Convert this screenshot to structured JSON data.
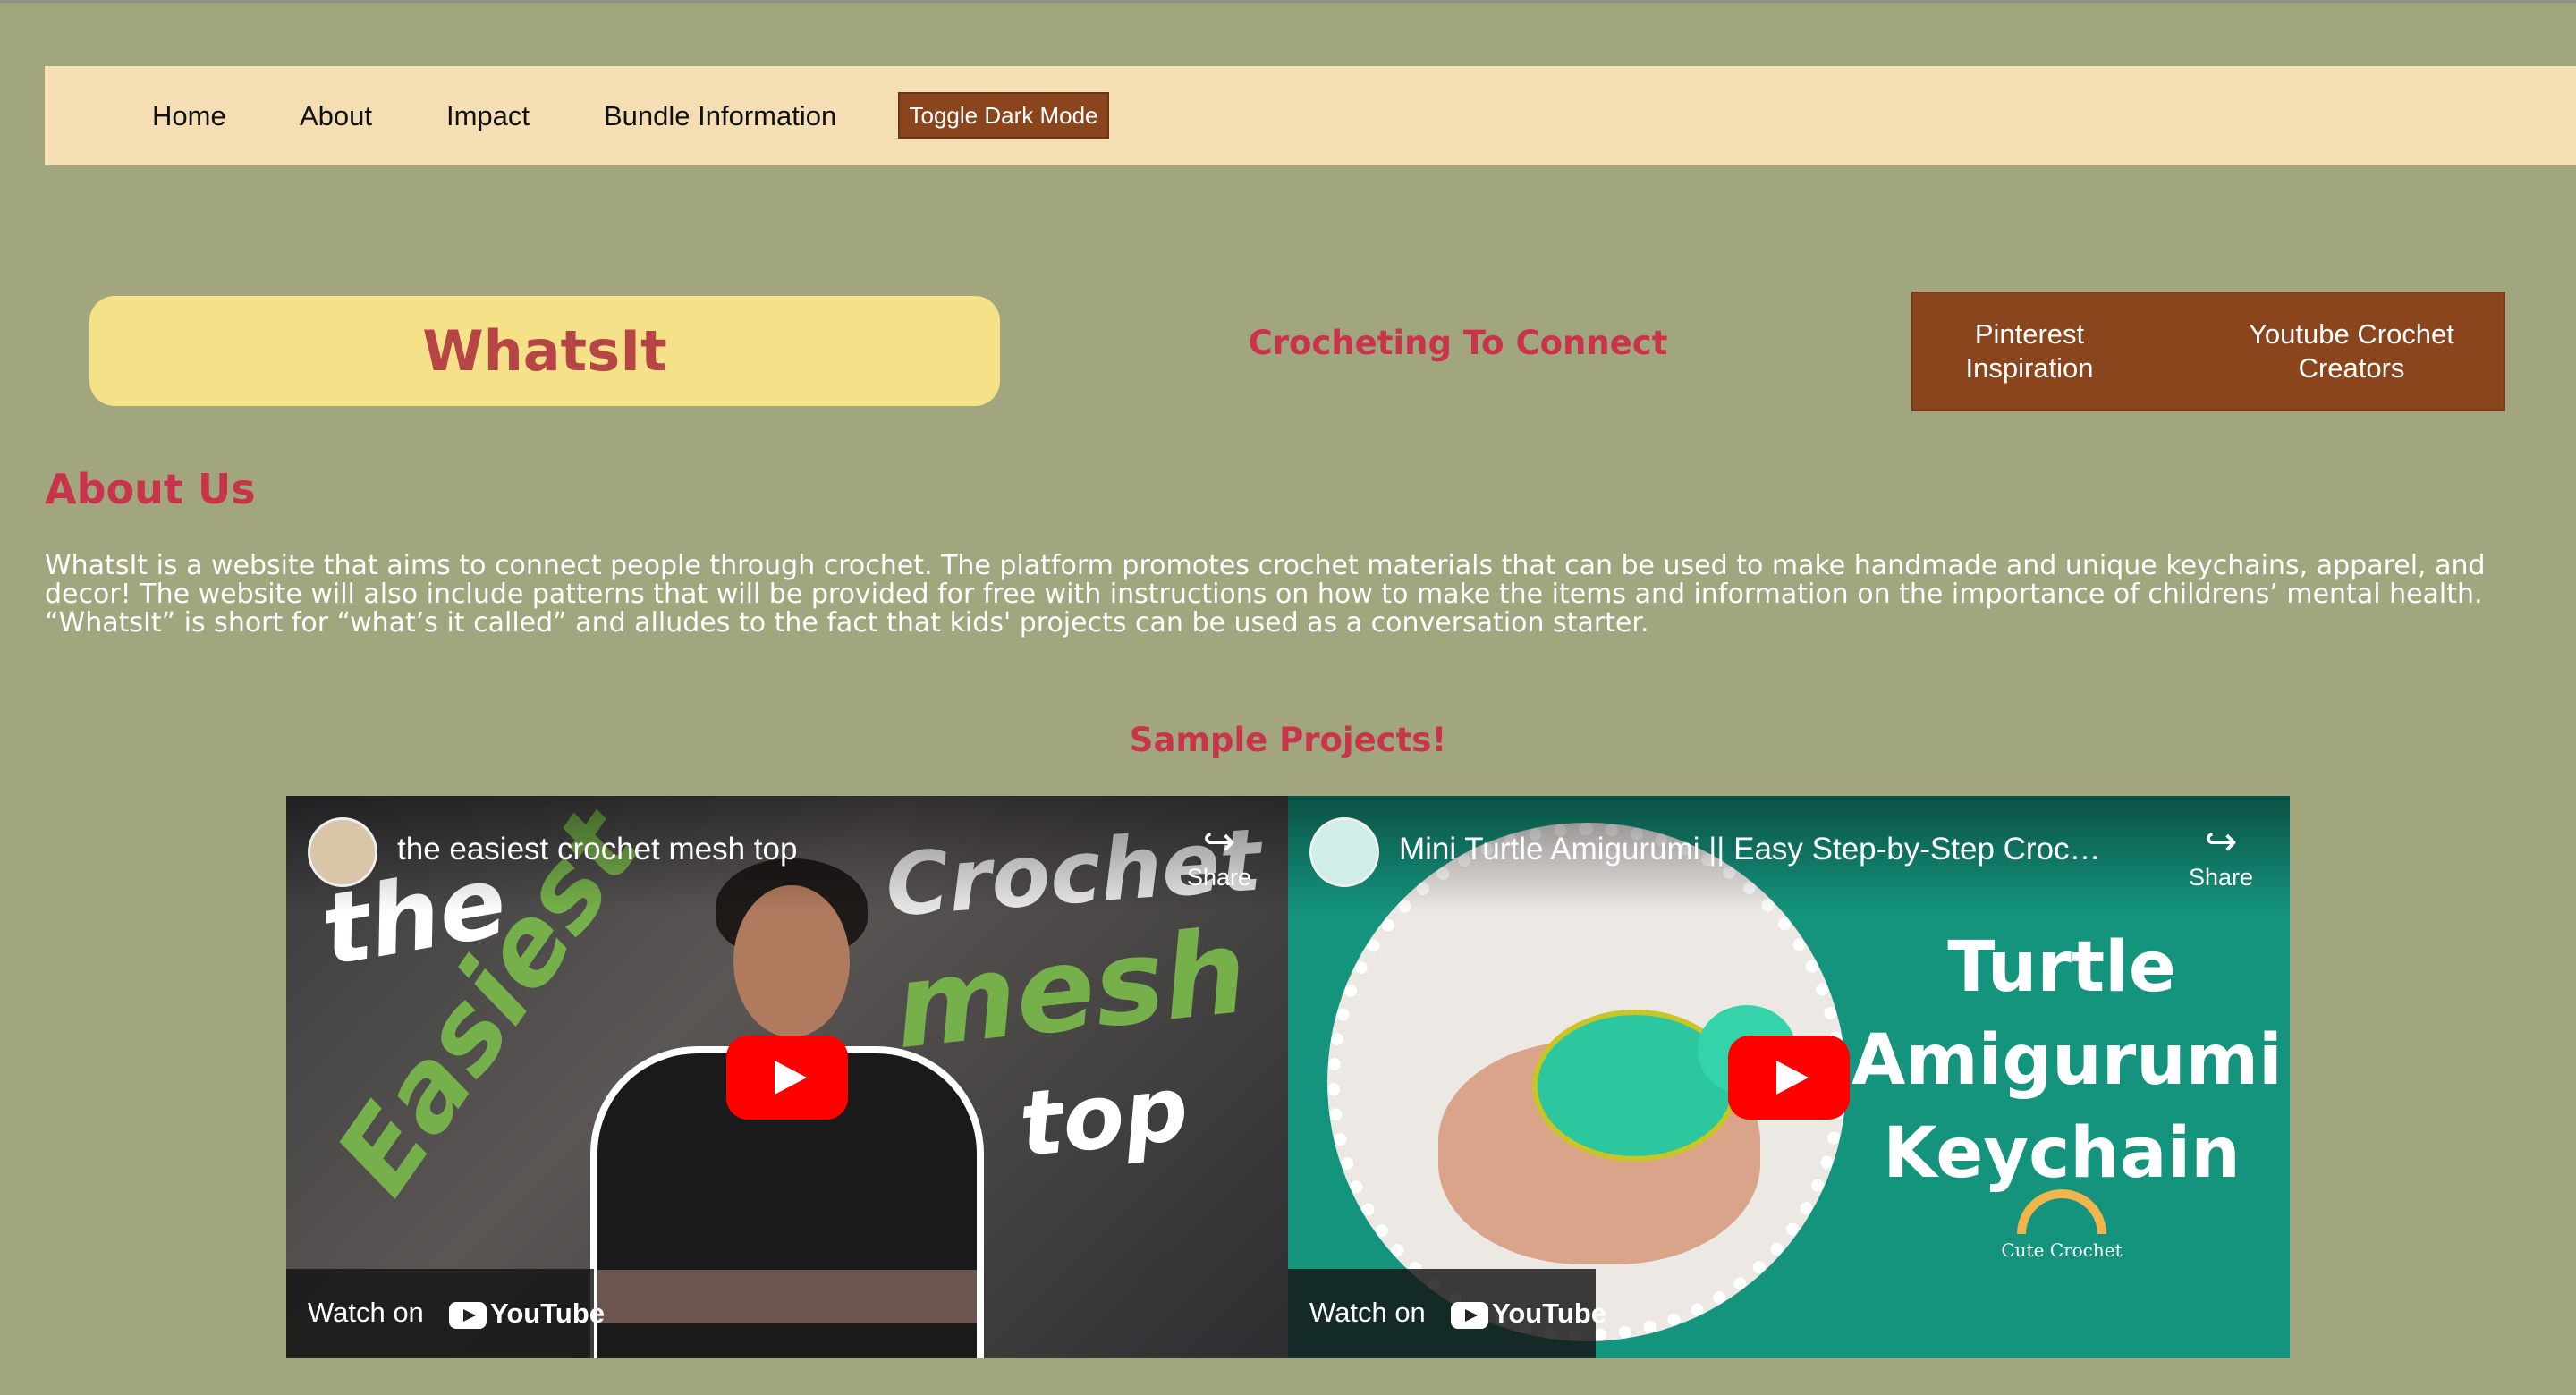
{
  "nav": {
    "items": [
      "Home",
      "About",
      "Impact",
      "Bundle Information"
    ],
    "toggle_label": "Toggle Dark Mode"
  },
  "header": {
    "brand": "WhatsIt",
    "tagline": "Crocheting To Connect",
    "links": [
      "Pinterest Inspiration",
      "Youtube Crochet Creators"
    ]
  },
  "about": {
    "heading": "About Us",
    "text": "WhatsIt is a website that aims to connect people through crochet. The platform promotes crochet materials that can be used to make handmade and unique keychains, apparel, and decor! The website will also include patterns that will be provided for free with instructions on how to make the items and information on the importance of childrens’ mental health. “WhatsIt” is short for “what’s it called” and alludes to the fact that kids' projects can be used as a conversation starter."
  },
  "samples": {
    "heading": "Sample Projects!",
    "videos": [
      {
        "title": "the easiest crochet mesh top",
        "share": "Share",
        "watch_on": "Watch on",
        "platform": "YouTube",
        "thumb_words": [
          "the",
          "Easiest",
          "Crochet",
          "mesh",
          "top"
        ]
      },
      {
        "title": "Mini Turtle Amigurumi || Easy Step-by-Step Crochet...",
        "share": "Share",
        "watch_on": "Watch on",
        "platform": "YouTube",
        "thumb_words": [
          "Turtle",
          "Amigurumi",
          "Keychain"
        ],
        "logo_text": "Cute Crochet"
      }
    ]
  },
  "colors": {
    "page_bg": "#a2a67e",
    "nav_bg": "#f5deb4",
    "accent_brown": "#8b451c",
    "brand_box": "#f5e188",
    "heading_red": "#c8344b"
  },
  "icons": [
    "share-icon",
    "play-icon",
    "youtube-logo-icon",
    "channel-avatar-icon"
  ]
}
